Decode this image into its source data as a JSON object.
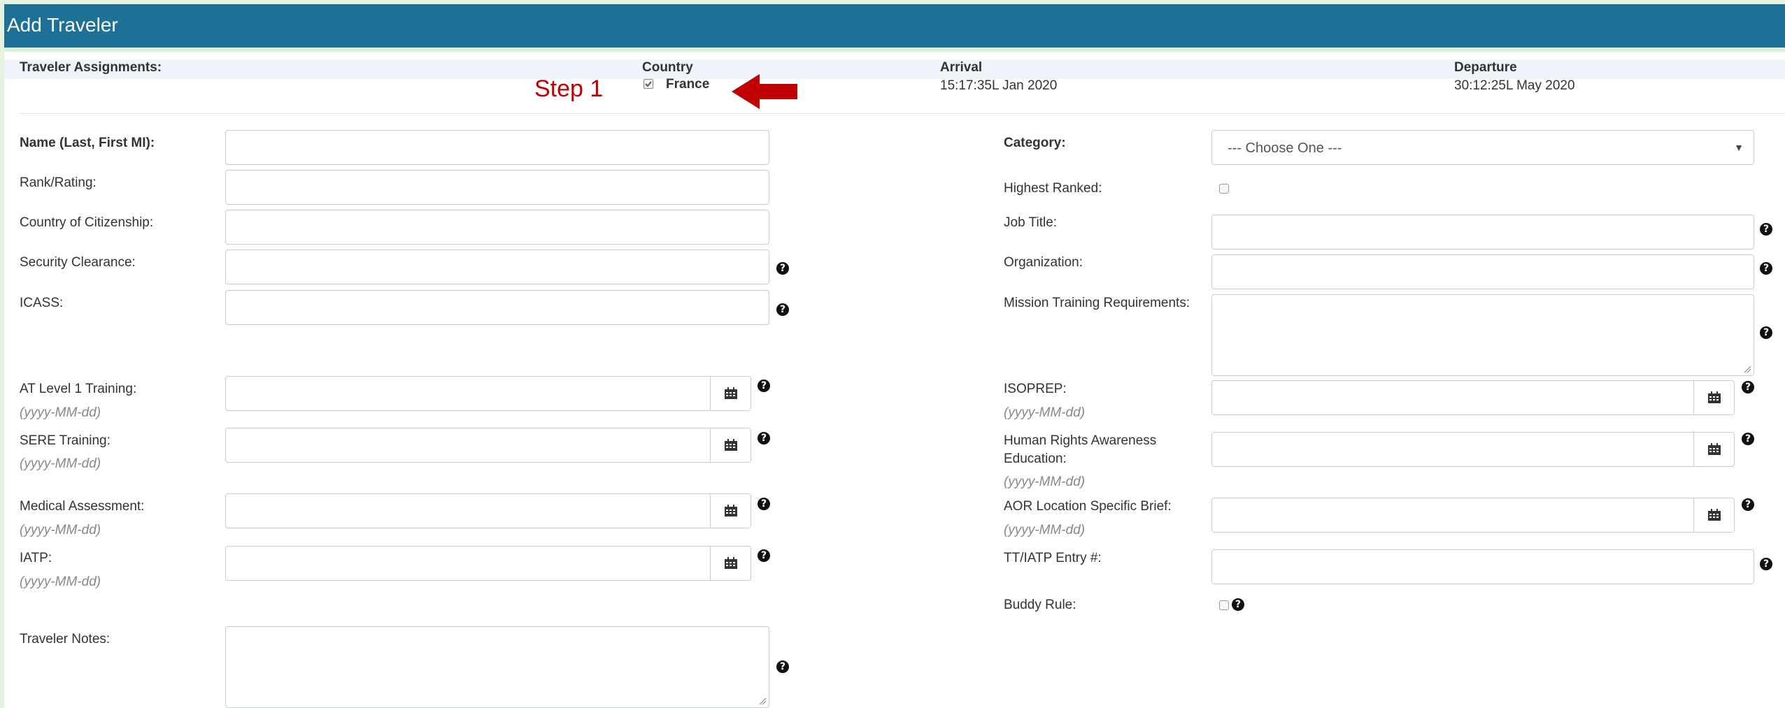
{
  "header": {
    "title": "Add Traveler"
  },
  "assignments": {
    "label": "Traveler Assignments:",
    "country_header": "Country",
    "country_value": "France",
    "country_checked": true,
    "arrival_header": "Arrival",
    "arrival_value": "15:17:35L Jan 2020",
    "departure_header": "Departure",
    "departure_value": "30:12:25L May 2020"
  },
  "annotation": {
    "step_label": "Step 1",
    "arrow_color": "#c00000"
  },
  "left_form": {
    "name_label": "Name (Last, First MI):",
    "rank_label": "Rank/Rating:",
    "citizenship_label": "Country of Citizenship:",
    "clearance_label": "Security Clearance:",
    "icass_label": "ICASS:",
    "at_level_label": "AT Level 1 Training:",
    "sere_label": "SERE Training:",
    "medical_label": "Medical Assessment:",
    "iatp_label": "IATP:",
    "notes_label": "Traveler Notes:",
    "date_hint": "(yyyy-MM-dd)"
  },
  "right_form": {
    "category_label": "Category:",
    "category_selected": "--- Choose One ---",
    "highest_ranked_label": "Highest Ranked:",
    "job_title_label": "Job Title:",
    "organization_label": "Organization:",
    "mission_training_label": "Mission Training Requirements:",
    "isoprep_label": "ISOPREP:",
    "human_rights_label_1": "Human Rights Awareness",
    "human_rights_label_2": "Education:",
    "aor_label": "AOR Location Specific Brief:",
    "tt_iatp_label": "TT/IATP Entry #:",
    "buddy_rule_label": "Buddy Rule:",
    "date_hint": "(yyyy-MM-dd)"
  },
  "icons": {
    "help": "question-circle-icon",
    "calendar": "calendar-icon",
    "checkmark": "check-icon",
    "arrow": "arrow-left-icon"
  },
  "colors": {
    "header_bg": "#1d7197",
    "page_border": "#e6f2e2",
    "annotation": "#c00000"
  }
}
